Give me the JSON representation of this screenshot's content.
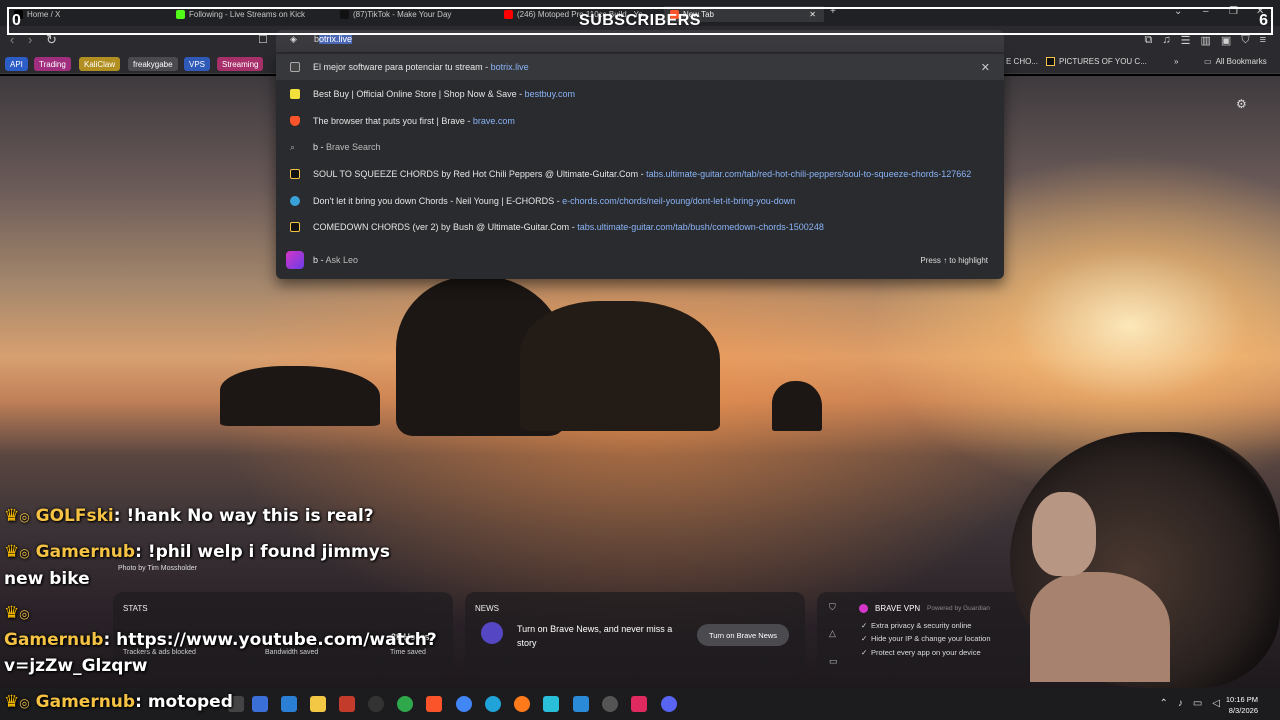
{
  "overlay": {
    "count_left": "0",
    "title": "SUBSCRIBERS",
    "count_right": "6"
  },
  "tabs": [
    {
      "label": "Home / X",
      "icon": "x-icon"
    },
    {
      "label": "Following - Live Streams on Kick",
      "icon": "kick-icon"
    },
    {
      "label": "(87)TikTok - Make Your Day",
      "icon": "tiktok-icon"
    },
    {
      "label": "(246) Motoped Pro 110cc Build - Yo...",
      "icon": "youtube-icon"
    },
    {
      "label": "New Tab",
      "icon": "brave-icon"
    }
  ],
  "omnibox": {
    "typed": "b",
    "autocomplete": "otrix.live"
  },
  "bookmarks": [
    {
      "label": "API",
      "color": "#2c5cc5"
    },
    {
      "label": "Trading",
      "color": "#c0399a"
    },
    {
      "label": "KaliClaw",
      "color": "#c9a62b"
    },
    {
      "label": "freakygabe",
      "color": "#555"
    },
    {
      "label": "VPS",
      "color": "#2f5ab8"
    },
    {
      "label": "Streaming",
      "color": "#c23b7a"
    }
  ],
  "bookmarks_right": [
    "E CHO...",
    "PICTURES OF YOU C...",
    "All Bookmarks"
  ],
  "suggestions": [
    {
      "text": "El mejor software para potenciar tu stream",
      "url": "botrix.live",
      "icon": "botrix-icon"
    },
    {
      "text": "Best Buy | Official Online Store | Shop Now & Save",
      "url": "bestbuy.com",
      "icon": "bestbuy-icon"
    },
    {
      "text": "The browser that puts you first | Brave",
      "url": "brave.com",
      "icon": "brave-icon"
    },
    {
      "text": "b",
      "url": "",
      "suffix": "Brave Search",
      "icon": "search-icon"
    },
    {
      "text": "SOUL TO SQUEEZE CHORDS by Red Hot Chili Peppers @ Ultimate-Guitar.Com",
      "url": "tabs.ultimate-guitar.com/tab/red-hot-chili-peppers/soul-to-squeeze-chords-127662",
      "icon": "ultimate-guitar-icon"
    },
    {
      "text": "Don't let it bring you down Chords - Neil Young | E-CHORDS",
      "url": "e-chords.com/chords/neil-young/dont-let-it-bring-you-down",
      "icon": "echords-icon"
    },
    {
      "text": "COMEDOWN CHORDS (ver 2) by Bush @ Ultimate-Guitar.Com",
      "url": "tabs.ultimate-guitar.com/tab/bush/comedown-chords-1500248",
      "icon": "ultimate-guitar-icon"
    }
  ],
  "ask_leo": {
    "query": "b",
    "label": "Ask Leo",
    "hint": "Press ↑ to highlight"
  },
  "chat": [
    {
      "user": "GOLFski",
      "message": "!hank No way this is real?"
    },
    {
      "user": "Gamernub",
      "message": "!phil welp i found jimmys",
      "message2": "new bike"
    },
    {
      "user": "Gamernub",
      "message": "https://www.youtube.com/watch?",
      "message2": "v=jzZw_Glzqrw"
    },
    {
      "user": "Gamernub",
      "message": "motoped"
    }
  ],
  "photo_credit": "Photo by Tim Mossholder",
  "stats": {
    "title": "STATS",
    "items": [
      {
        "value": "",
        "label": "Trackers & ads blocked"
      },
      {
        "value": "",
        "label": "Bandwidth saved"
      },
      {
        "value": "28 Hours",
        "label": "Time saved"
      }
    ]
  },
  "news": {
    "title": "NEWS",
    "text": "Turn on Brave News, and never miss a story",
    "button": "Turn on Brave News"
  },
  "vpn": {
    "title": "BRAVE VPN",
    "powered": "Powered by Guardian",
    "features": [
      "Extra privacy & security online",
      "Hide your IP & change your location",
      "Protect every app on your device"
    ]
  },
  "clock": {
    "time": "10:16 PM",
    "date": "8/3/2026"
  }
}
